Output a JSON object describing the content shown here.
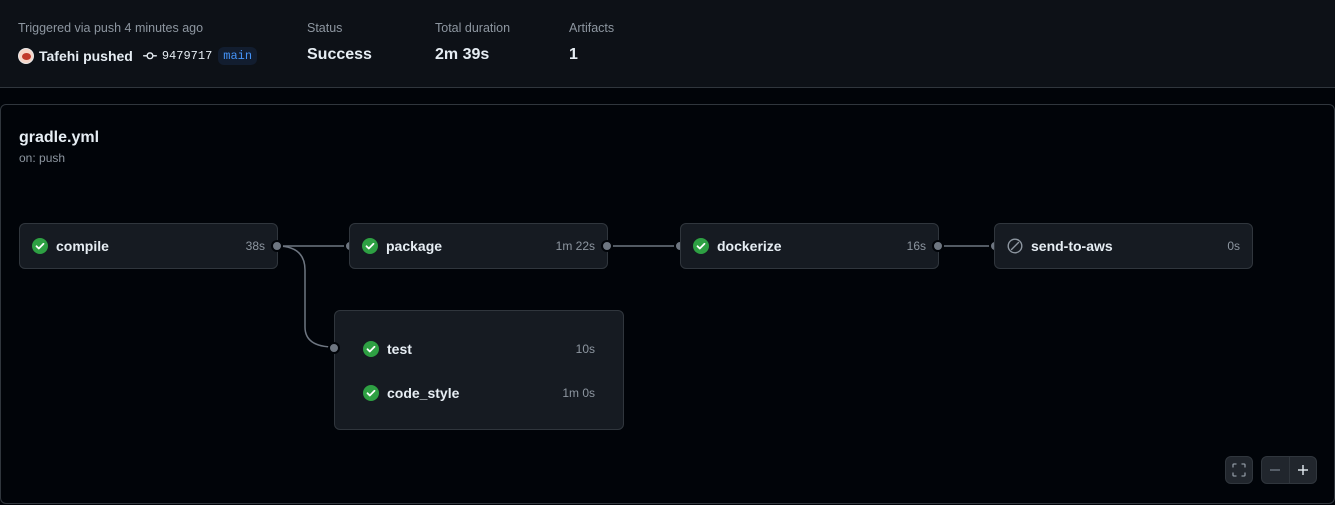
{
  "summary": {
    "trigger": {
      "label": "Triggered via push 4 minutes ago",
      "pusher": "Tafehi pushed",
      "sha": "9479717",
      "branch": "main"
    },
    "status": {
      "label": "Status",
      "value": "Success"
    },
    "duration": {
      "label": "Total duration",
      "value": "2m 39s"
    },
    "artifacts": {
      "label": "Artifacts",
      "value": "1"
    }
  },
  "workflow": {
    "title": "gradle.yml",
    "subtitle": "on: push",
    "jobs": {
      "compile": {
        "name": "compile",
        "duration": "38s",
        "status": "success"
      },
      "package": {
        "name": "package",
        "duration": "1m 22s",
        "status": "success"
      },
      "dockerize": {
        "name": "dockerize",
        "duration": "16s",
        "status": "success"
      },
      "send_to_aws": {
        "name": "send-to-aws",
        "duration": "0s",
        "status": "skipped"
      },
      "test": {
        "name": "test",
        "duration": "10s",
        "status": "success"
      },
      "code_style": {
        "name": "code_style",
        "duration": "1m 0s",
        "status": "success"
      }
    }
  },
  "colors": {
    "success": "#2ea043",
    "skipped": "#8d96a0",
    "branch_text": "#4493f8"
  },
  "icons": {
    "success": "check-circle-fill-icon",
    "skipped": "skip-icon",
    "commit": "git-commit-icon",
    "fullscreen": "fullscreen-icon",
    "zoom_out": "zoom-out-icon",
    "zoom_in": "zoom-in-icon"
  }
}
